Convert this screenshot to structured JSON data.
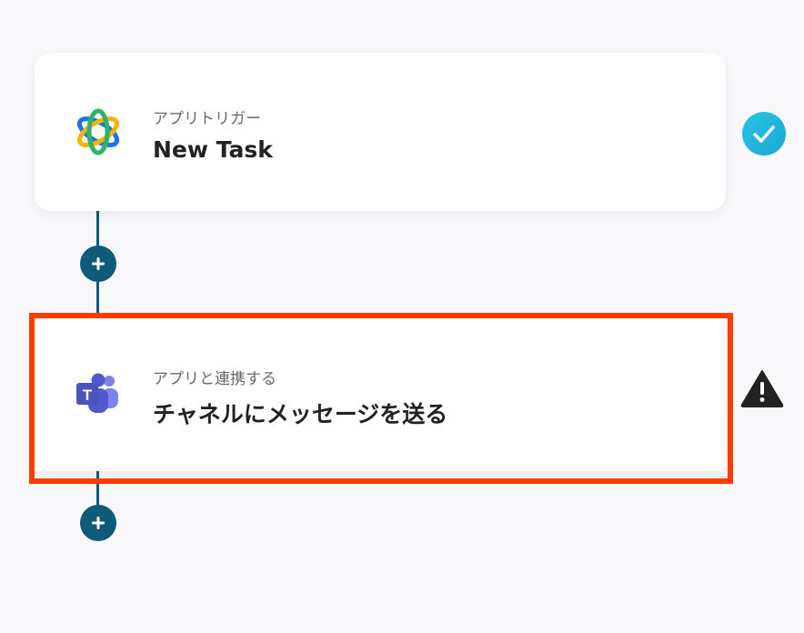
{
  "steps": [
    {
      "app_icon": "asana-logo-icon",
      "subtitle": "アプリトリガー",
      "title": "New Task",
      "status_icon": "check-circle-icon",
      "status_color": "#1fb6d9"
    },
    {
      "app_icon": "microsoft-teams-logo-icon",
      "subtitle": "アプリと連携する",
      "title": "チャネルにメッセージを送る",
      "status_icon": "warning-triangle-icon",
      "status_color": "#222222"
    }
  ],
  "colors": {
    "connector": "#0f5a78",
    "highlight": "#ff3b00",
    "background": "#f8f8fb"
  },
  "add_icon": "plus-icon"
}
